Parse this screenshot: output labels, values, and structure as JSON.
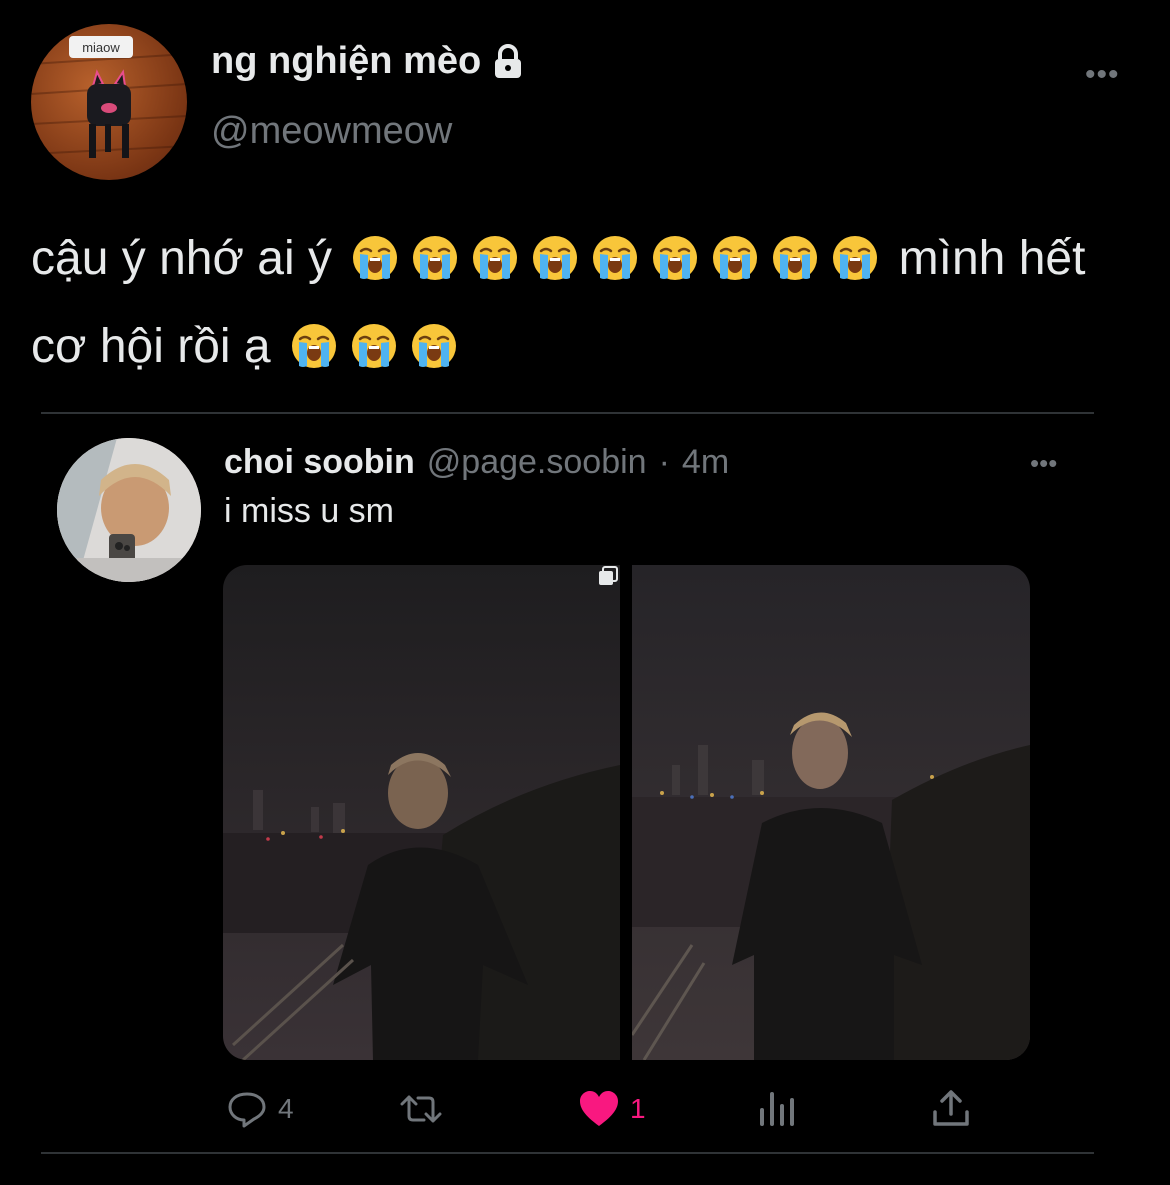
{
  "tweet": {
    "display_name": "ng nghiện mèo",
    "handle": "@meowmeow",
    "avatar_badge": "miaow",
    "text_line1_start": "cậu ý nhớ ai ý",
    "text_line1_end": "mình hết",
    "text_line2_start": "cơ hội rồi ạ",
    "emoji": "loudly-crying-face",
    "more_label": "•••"
  },
  "quoted": {
    "display_name": "choi soobin",
    "handle": "@page.soobin",
    "separator": "·",
    "time": "4m",
    "text": "i miss u sm",
    "more_label": "•••"
  },
  "actions": {
    "reply_count": "4",
    "retweet_count": "",
    "like_count": "1",
    "like_active_color": "#f91880"
  }
}
